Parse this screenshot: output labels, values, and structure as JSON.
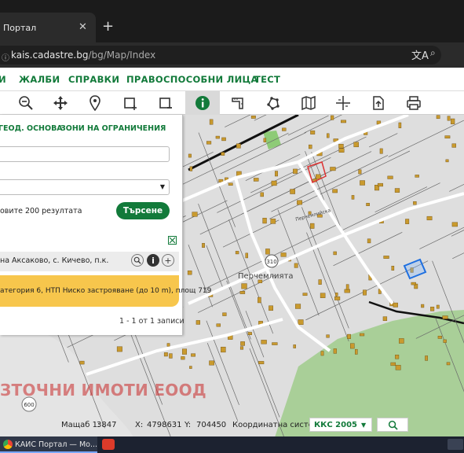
{
  "browser": {
    "tab_title": "Портал",
    "tab_close": "✕",
    "new_tab": "+",
    "url_host": "kais.cadastre.bg",
    "url_path": "/bg/Map/Index"
  },
  "nav": {
    "items": [
      "И",
      "ЖАЛБИ",
      "СПРАВКИ",
      "ПРАВОСПОСОБНИ ЛИЦА",
      "ТЕСТ"
    ]
  },
  "toolbar": {
    "tools": [
      "zoom-out",
      "pan",
      "locate",
      "select-rectangle",
      "clear-selection",
      "info",
      "measure",
      "draw-polygon",
      "layers",
      "coordinates",
      "export",
      "print"
    ]
  },
  "panel": {
    "tabs": [
      "ГЕОД. ОСНОВА",
      "ЗОНИ НА ОГРАНИЧЕНИЯ"
    ],
    "field1_value": "",
    "field2_value": "",
    "results_hint": "овите 200 резултата",
    "search_label": "Търсене",
    "result_text": "на Аксаково, с. Кичево, п.к.",
    "result_detail": "атегория 6, НТП Ниско застрояване (до 10 m), площ 719",
    "pagination": "1 - 1 от 1 записи"
  },
  "map": {
    "watermark": "ЗТОЧНИ ИМОТИ ЕООД",
    "village_label": "Перчемлията",
    "street_label": "Перчемлийска",
    "road_number": "310",
    "parcel_label": "600"
  },
  "status": {
    "scale_label": "Мащаб 1:",
    "scale_value": "3847",
    "x_label": "X:",
    "x_value": "4798631",
    "y_label": "Y:",
    "y_value": "704450",
    "crs_label": "Координатна система:",
    "crs_value": "ККС 2005"
  },
  "taskbar": {
    "app_title": "КАИС Портал — Мо..."
  },
  "colors": {
    "brand_green": "#127a3a",
    "highlight": "#f7c64c",
    "map_bg": "#dedede",
    "forest": "#9dc98e"
  }
}
